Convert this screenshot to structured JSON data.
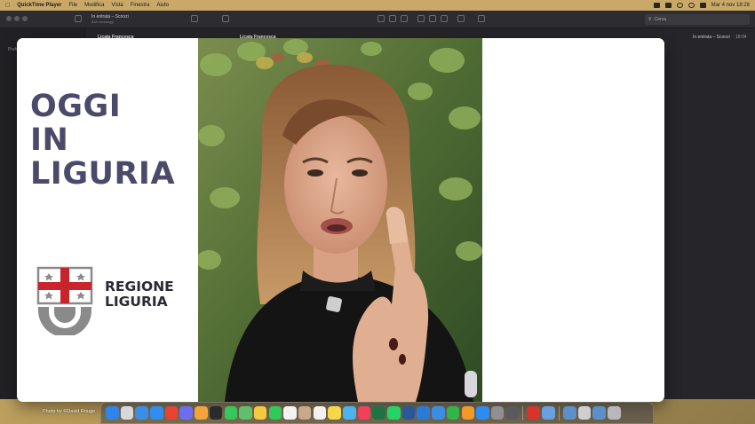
{
  "menubar": {
    "app_name": "QuickTime Player",
    "items": [
      "File",
      "Modifica",
      "Vista",
      "Finestra",
      "Aiuto"
    ],
    "clock": "Mar 4 nov  18:28"
  },
  "mail": {
    "mailbox_title": "In entrata – Scoozi",
    "mailbox_subtitle": "836 messaggi",
    "sidebar_label": "Preferiti",
    "search_placeholder": "Cerca",
    "sender": "Licata Francesca",
    "list_sender": "Licata Francesca",
    "folder": "In entrata – Scoozi",
    "time": "18:04"
  },
  "video": {
    "headline": [
      "OGGI",
      "IN",
      "LIGURIA"
    ],
    "region_name": [
      "REGIONE",
      "LIGURIA"
    ],
    "colors": {
      "headline": "#4a4a6a",
      "emblem_red": "#c8242b",
      "emblem_gray": "#8a8a8a"
    }
  },
  "wallpaper": {
    "credit": "Photo by ©David Rouge"
  },
  "dock": {
    "icons": [
      {
        "name": "finder-icon",
        "color": "#2f86e8"
      },
      {
        "name": "launchpad-icon",
        "color": "#d7d7dc"
      },
      {
        "name": "mail-icon",
        "color": "#3a8ee6"
      },
      {
        "name": "safari-icon",
        "color": "#2f8ef0"
      },
      {
        "name": "chrome-icon",
        "color": "#e94335"
      },
      {
        "name": "siri-icon",
        "color": "#6d6df0"
      },
      {
        "name": "photos-icon",
        "color": "#f2a33a"
      },
      {
        "name": "terminal-icon",
        "color": "#2b2b2b"
      },
      {
        "name": "messages-icon",
        "color": "#35c759"
      },
      {
        "name": "maps-icon",
        "color": "#5fbf6b"
      },
      {
        "name": "photos-app-icon",
        "color": "#f4c83f"
      },
      {
        "name": "facetime-icon",
        "color": "#34c759"
      },
      {
        "name": "calendar-icon",
        "color": "#f3f3f3"
      },
      {
        "name": "contacts-icon",
        "color": "#c9a98a"
      },
      {
        "name": "reminders-icon",
        "color": "#f2f2f2"
      },
      {
        "name": "notes-icon",
        "color": "#f7d74a"
      },
      {
        "name": "freeform-icon",
        "color": "#4db2f0"
      },
      {
        "name": "music-icon",
        "color": "#f2405b"
      },
      {
        "name": "excel-icon",
        "color": "#1f7244"
      },
      {
        "name": "whatsapp-icon",
        "color": "#25d366"
      },
      {
        "name": "word-icon",
        "color": "#2b579a"
      },
      {
        "name": "keynote-icon",
        "color": "#2a7bd8"
      },
      {
        "name": "quicktime-icon",
        "color": "#3b8de0"
      },
      {
        "name": "numbers-icon",
        "color": "#33b34a"
      },
      {
        "name": "pages-icon",
        "color": "#f09a2a"
      },
      {
        "name": "app-store-icon",
        "color": "#2d8cf0"
      },
      {
        "name": "system-settings-icon",
        "color": "#8e8e93"
      },
      {
        "name": "calculator-icon",
        "color": "#5a5a5e"
      },
      {
        "name": "acrobat-icon",
        "color": "#d9342b"
      },
      {
        "name": "preview-icon",
        "color": "#6aa0e0"
      },
      {
        "name": "folder-icon",
        "color": "#5d8fc8"
      },
      {
        "name": "document-icon",
        "color": "#cfcfcf"
      },
      {
        "name": "downloads-folder-icon",
        "color": "#5d8fc8"
      },
      {
        "name": "trash-icon",
        "color": "#b8b8bc"
      }
    ]
  }
}
